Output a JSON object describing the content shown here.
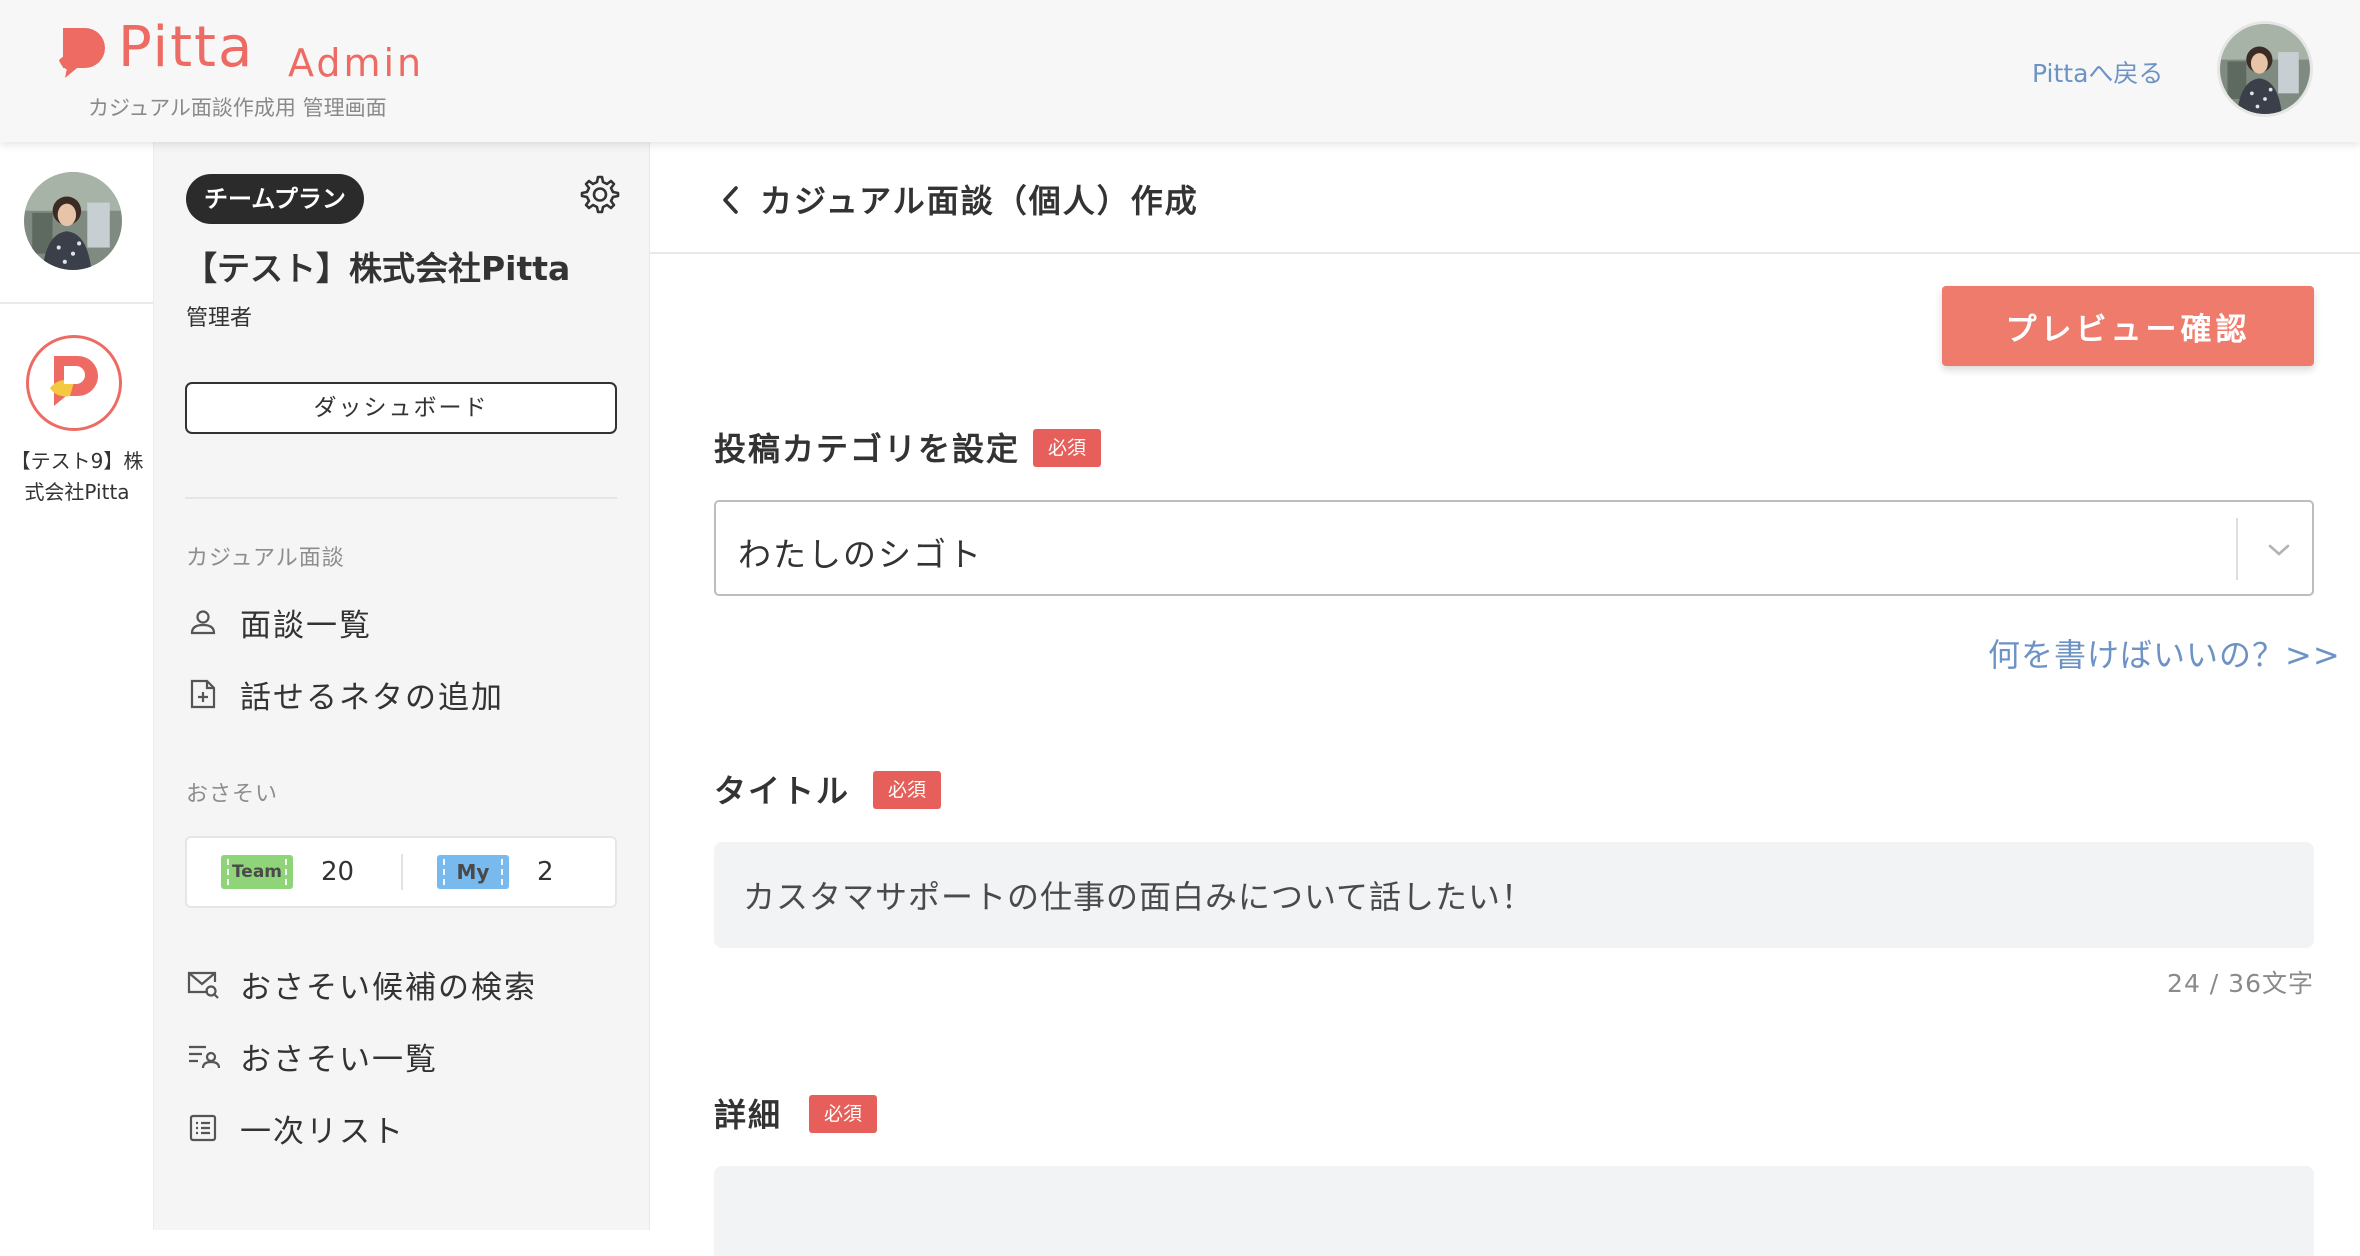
{
  "header": {
    "logo_word": "Pitta",
    "logo_admin": "Admin",
    "logo_subtitle": "カジュアル面談作成用 管理画面",
    "back_link": "Pittaへ戻る",
    "brand_color": "#ee6b63"
  },
  "rail": {
    "org_name": "【テスト9】株式会社Pitta"
  },
  "sidebar": {
    "plan_badge": "チームプラン",
    "org_title": "【テスト】株式会社Pitta",
    "role": "管理者",
    "dashboard_button": "ダッシュボード",
    "section_casual": "カジュアル面談",
    "casual_items": [
      {
        "label": "面談一覧",
        "icon": "user-icon"
      },
      {
        "label": "話せるネタの追加",
        "icon": "file-plus-icon"
      }
    ],
    "section_invite": "おさそい",
    "invite_counts": {
      "team_label": "Team",
      "team_count": "20",
      "team_color": "#8fd479",
      "my_label": "My",
      "my_count": "2",
      "my_color": "#78b9ee"
    },
    "invite_items": [
      {
        "label": "おさそい候補の検索",
        "icon": "mail-search-icon"
      },
      {
        "label": "おさそい一覧",
        "icon": "list-user-icon"
      },
      {
        "label": "一次リスト",
        "icon": "checklist-icon"
      }
    ]
  },
  "main": {
    "page_title": "カジュアル面談（個人）作成",
    "preview_button": "プレビュー確認",
    "category_label": "投稿カテゴリを設定",
    "required_badge": "必須",
    "category_value": "わたしのシゴト",
    "help_link": "何を書けばいいの？>>",
    "title_label": "タイトル",
    "title_value": "カスタマサポートの仕事の面白みについて話したい！",
    "title_count": "24 / 36文字",
    "detail_label": "詳細",
    "accent_color": "#ee7b6c",
    "required_color": "#e65f5a",
    "link_color": "#6d93c4"
  }
}
